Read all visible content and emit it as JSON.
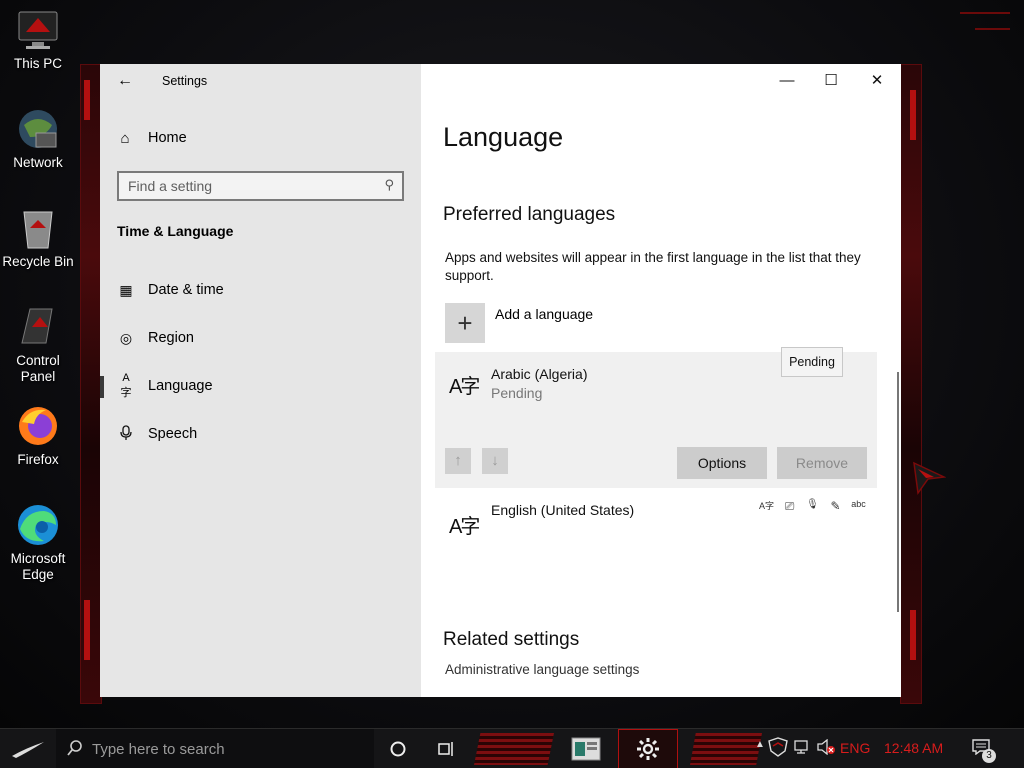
{
  "desktop": {
    "icons": [
      {
        "label": "This PC",
        "icon": "this-pc-icon"
      },
      {
        "label": "Network",
        "icon": "network-icon"
      },
      {
        "label": "Recycle Bin",
        "icon": "recycle-bin-icon"
      },
      {
        "label": "Control Panel",
        "icon": "control-panel-icon"
      },
      {
        "label": "Firefox",
        "icon": "firefox-icon"
      },
      {
        "label": "Microsoft Edge",
        "icon": "edge-icon"
      }
    ]
  },
  "window": {
    "title": "Settings",
    "back_icon": "←",
    "controls": {
      "minimize": "—",
      "maximize": "☐",
      "close": "✕"
    }
  },
  "nav": {
    "home": {
      "label": "Home",
      "icon": "⌂"
    },
    "search": {
      "placeholder": "Find a setting",
      "icon": "⚲"
    },
    "section": "Time & Language",
    "items": [
      {
        "label": "Date & time",
        "icon": "▦",
        "active": false
      },
      {
        "label": "Region",
        "icon": "◎",
        "active": false
      },
      {
        "label": "Language",
        "icon": "A字",
        "active": true
      },
      {
        "label": "Speech",
        "icon": "⊕",
        "active": false
      }
    ]
  },
  "content": {
    "page_title": "Language",
    "preferred_heading": "Preferred languages",
    "preferred_description": "Apps and websites will appear in the first language in the list that they support.",
    "add_language": {
      "label": "Add a language",
      "icon": "+"
    },
    "languages": [
      {
        "name": "Arabic (Algeria)",
        "status": "Pending",
        "glyph": "A字"
      },
      {
        "name": "English (United States)",
        "status": "",
        "glyph": "A字"
      }
    ],
    "options_button": "Options",
    "remove_button": "Remove",
    "move_up_icon": "↑",
    "move_down_icon": "↓",
    "tooltip": "Pending",
    "feature_icons": [
      "A字",
      "⎚",
      "🎙",
      "✎",
      "abc"
    ],
    "related_heading": "Related settings",
    "related_link": "Administrative language settings"
  },
  "taskbar": {
    "search_placeholder": "Type here to search",
    "lang": "ENG",
    "time": "12:48 AM",
    "notification_count": "3"
  },
  "colors": {
    "accent_red": "#d81c1c",
    "nav_bg": "#e6e6e6",
    "card_bg": "#f0f0f0"
  }
}
